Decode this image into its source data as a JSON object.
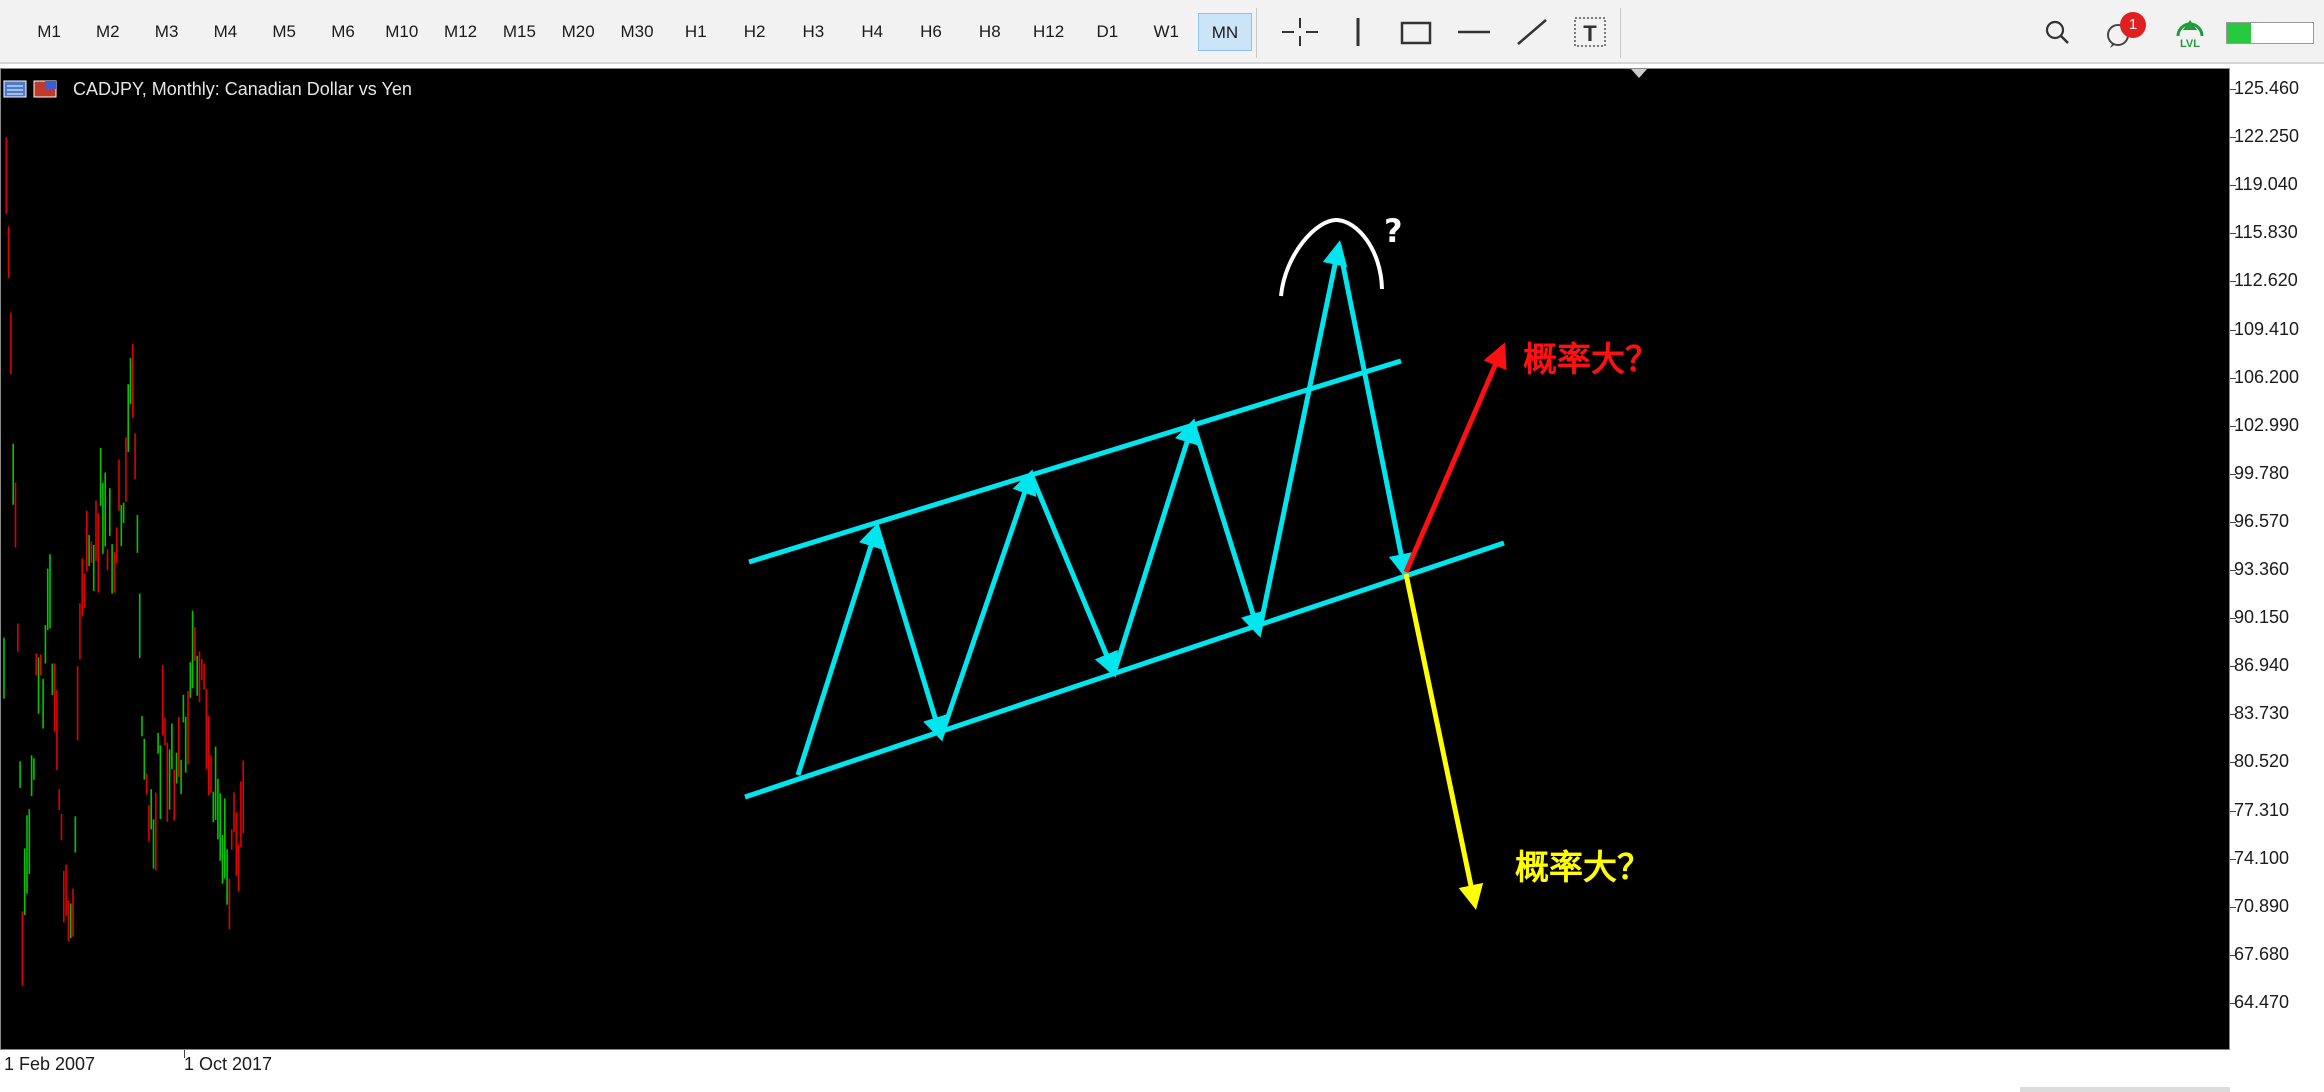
{
  "toolbar": {
    "timeframes": [
      "M1",
      "M2",
      "M3",
      "M4",
      "M5",
      "M6",
      "M10",
      "M12",
      "M15",
      "M20",
      "M30",
      "H1",
      "H2",
      "H3",
      "H4",
      "H6",
      "H8",
      "H12",
      "D1",
      "W1",
      "MN"
    ],
    "active_timeframe": "MN",
    "tools": [
      "crosshair-icon",
      "vertical-line-icon",
      "rectangle-icon",
      "horizontal-line-icon",
      "trendline-icon",
      "text-label-icon"
    ],
    "notification_count": "1",
    "level_badge": "LVL",
    "colors": {
      "active_bg": "#cce4f7",
      "notification": "#e02020",
      "level": "#1f9d3a"
    }
  },
  "chart": {
    "title": "CADJPY, Monthly:  Canadian Dollar vs Yen",
    "background": "#000000",
    "price_labels": [
      "125.460",
      "122.250",
      "119.040",
      "115.830",
      "112.620",
      "109.410",
      "106.200",
      "102.990",
      "99.780",
      "96.570",
      "93.360",
      "90.150",
      "86.940",
      "83.730",
      "80.520",
      "77.310",
      "74.100",
      "70.890",
      "67.680",
      "64.470"
    ],
    "time_labels": [
      "1 Feb 2007",
      "1 Oct 2017"
    ],
    "annotations": {
      "question_mark": "?",
      "up_label": "概率大？",
      "down_label": "概率大？",
      "colors": {
        "channel": "#00e5ee",
        "up": "#ff1010",
        "down": "#ffff00",
        "topper": "#ffffff",
        "bull_candle": "#00c800",
        "bear_candle": "#e00000"
      }
    }
  }
}
